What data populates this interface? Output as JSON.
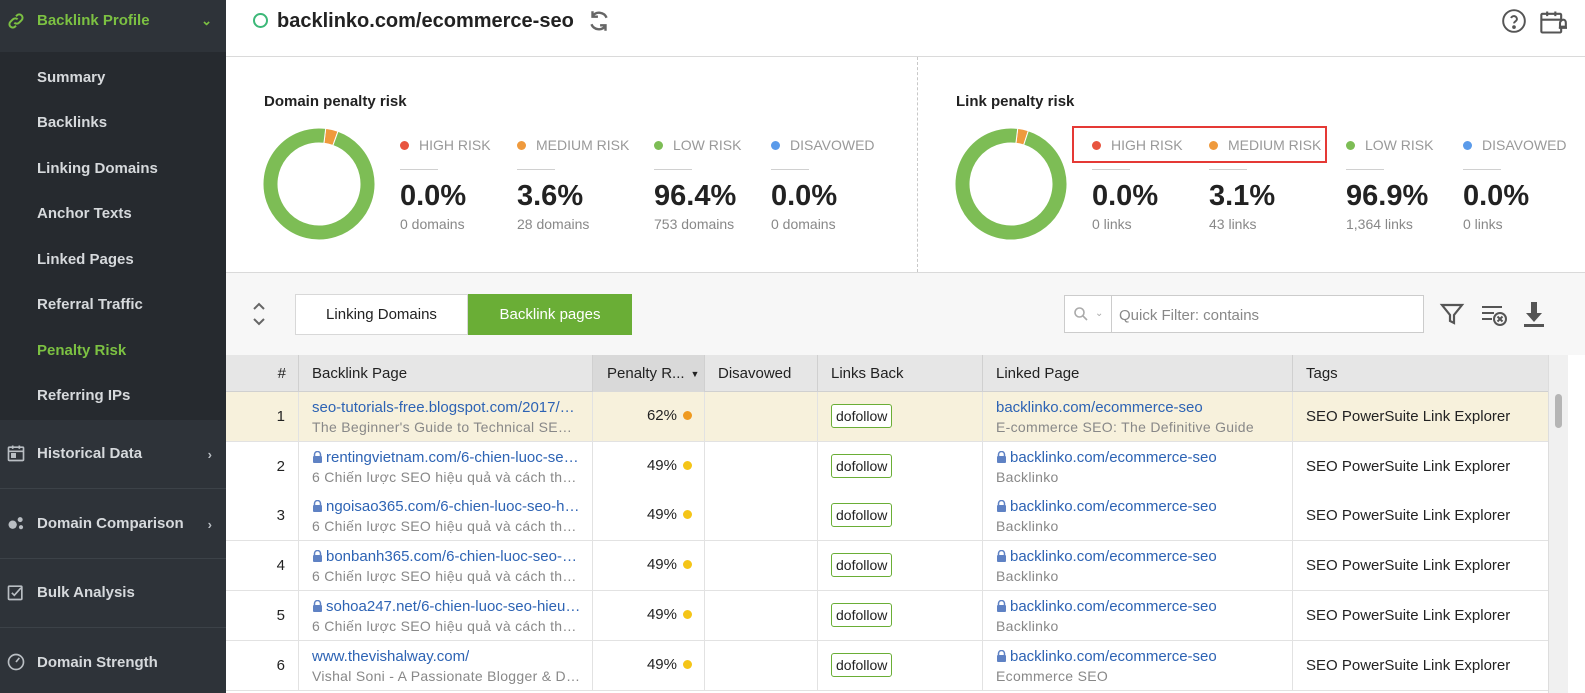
{
  "sidebar": {
    "backlink_profile": "Backlink Profile",
    "items": [
      {
        "label": "Summary"
      },
      {
        "label": "Backlinks"
      },
      {
        "label": "Linking Domains"
      },
      {
        "label": "Anchor Texts"
      },
      {
        "label": "Linked Pages"
      },
      {
        "label": "Referral Traffic"
      },
      {
        "label": "Penalty Risk"
      },
      {
        "label": "Referring IPs"
      }
    ],
    "historical_data": "Historical Data",
    "domain_comparison": "Domain Comparison",
    "bulk_analysis": "Bulk Analysis",
    "domain_strength": "Domain Strength"
  },
  "header": {
    "title": "backlinko.com/ecommerce-seo"
  },
  "domain_risk": {
    "title": "Domain penalty risk",
    "legend": [
      "HIGH RISK",
      "MEDIUM RISK",
      "LOW RISK",
      "DISAVOWED"
    ],
    "values": [
      "0.0%",
      "3.6%",
      "96.4%",
      "0.0%"
    ],
    "counts": [
      "0 domains",
      "28 domains",
      "753 domains",
      "0 domains"
    ],
    "fractions": [
      0.0,
      0.036,
      0.964,
      0.0
    ]
  },
  "link_risk": {
    "title": "Link penalty risk",
    "legend": [
      "HIGH RISK",
      "MEDIUM RISK",
      "LOW RISK",
      "DISAVOWED"
    ],
    "values": [
      "0.0%",
      "3.1%",
      "96.9%",
      "0.0%"
    ],
    "counts": [
      "0 links",
      "43 links",
      "1,364 links",
      "0 links"
    ],
    "fractions": [
      0.0,
      0.031,
      0.969,
      0.0
    ]
  },
  "colors": {
    "high": "#e8543f",
    "medium": "#ef9a3d",
    "low": "#7dbd55",
    "disavowed": "#5b9bea",
    "accent": "#6aae36",
    "yellow": "#f5c518",
    "orange": "#ef9a20"
  },
  "tabs": {
    "linking_domains": "Linking Domains",
    "backlink_pages": "Backlink pages"
  },
  "filter": {
    "placeholder": "Quick Filter: contains"
  },
  "table": {
    "headers": [
      "#",
      "Backlink Page",
      "Penalty R...",
      "Disavowed",
      "Links Back",
      "Linked Page",
      "Tags"
    ],
    "rows": [
      {
        "n": "1",
        "url": "seo-tutorials-free.blogspot.com/2017/03...",
        "title": "The Beginner's Guide to Technical SEO |...",
        "secure": false,
        "penalty": "62%",
        "risk": "orange",
        "links_back": "dofollow",
        "linked_url": "backlinko.com/ecommerce-seo",
        "linked_title": "E-commerce SEO: The Definitive Guide",
        "linked_secure": false,
        "tag": "SEO PowerSuite Link Explorer"
      },
      {
        "n": "2",
        "url": "rentingvietnam.com/6-chien-luoc-seo-...",
        "title": "6 Chiến lược SEO hiệu quả và cách thực...",
        "secure": true,
        "penalty": "49%",
        "risk": "yellow",
        "links_back": "dofollow",
        "linked_url": "backlinko.com/ecommerce-seo",
        "linked_title": "Backlinko",
        "linked_secure": true,
        "tag": "SEO PowerSuite Link Explorer"
      },
      {
        "n": "3",
        "url": "ngoisao365.com/6-chien-luoc-seo-hie...",
        "title": "6 Chiến lược SEO hiệu quả và cách thực...",
        "secure": true,
        "penalty": "49%",
        "risk": "yellow",
        "links_back": "dofollow",
        "linked_url": "backlinko.com/ecommerce-seo",
        "linked_title": "Backlinko",
        "linked_secure": true,
        "tag": "SEO PowerSuite Link Explorer"
      },
      {
        "n": "4",
        "url": "bonbanh365.com/6-chien-luoc-seo-hi...",
        "title": "6 Chiến lược SEO hiệu quả và cách thực...",
        "secure": true,
        "penalty": "49%",
        "risk": "yellow",
        "links_back": "dofollow",
        "linked_url": "backlinko.com/ecommerce-seo",
        "linked_title": "Backlinko",
        "linked_secure": true,
        "tag": "SEO PowerSuite Link Explorer"
      },
      {
        "n": "5",
        "url": "sohoa247.net/6-chien-luoc-seo-hieu-q...",
        "title": "6 Chiến lược SEO hiệu quả và cách thực...",
        "secure": true,
        "penalty": "49%",
        "risk": "yellow",
        "links_back": "dofollow",
        "linked_url": "backlinko.com/ecommerce-seo",
        "linked_title": "Backlinko",
        "linked_secure": true,
        "tag": "SEO PowerSuite Link Explorer"
      },
      {
        "n": "6",
        "url": "www.thevishalway.com/",
        "title": "Vishal Soni - A Passionate Blogger & Digi...",
        "secure": false,
        "penalty": "49%",
        "risk": "yellow",
        "links_back": "dofollow",
        "linked_url": "backlinko.com/ecommerce-seo",
        "linked_title": "Ecommerce SEO",
        "linked_secure": true,
        "tag": "SEO PowerSuite Link Explorer"
      }
    ]
  }
}
